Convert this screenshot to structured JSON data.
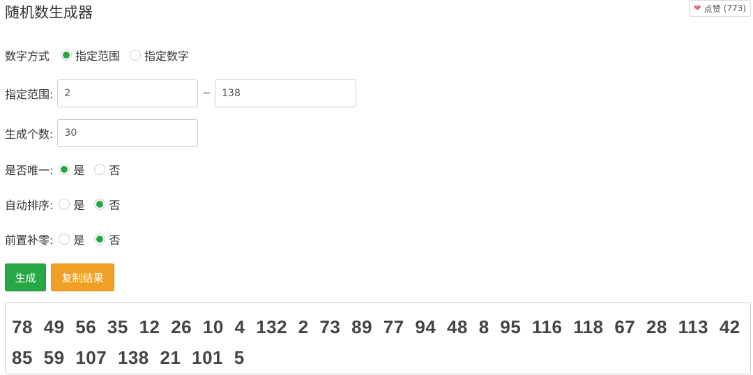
{
  "page": {
    "title": "随机数生成器"
  },
  "like": {
    "icon": "heart-icon",
    "label": "点赞",
    "count": "(773)",
    "color": "#e06a7a"
  },
  "form": {
    "mode": {
      "label": "数字方式",
      "options": [
        "指定范围",
        "指定数字"
      ],
      "selected": "指定范围"
    },
    "range": {
      "label": "指定范围:",
      "min": "2",
      "separator": "~",
      "max": "138"
    },
    "count": {
      "label": "生成个数:",
      "value": "30"
    },
    "unique": {
      "label": "是否唯一:",
      "options": [
        "是",
        "否"
      ],
      "selected": "是"
    },
    "sort": {
      "label": "自动排序:",
      "options": [
        "是",
        "否"
      ],
      "selected": "否"
    },
    "pad_zero": {
      "label": "前置补零:",
      "options": [
        "是",
        "否"
      ],
      "selected": "否"
    }
  },
  "actions": {
    "generate_label": "生成",
    "copy_label": "复制结果",
    "generate_color": "#28a745",
    "copy_color": "#f0a024"
  },
  "result": {
    "text": "78 49 56  35 12  26 10 4 132 2 73 89  77 94 48 8 95 116 118 67 28 113 42 85  59 107 138 21 101 5"
  }
}
